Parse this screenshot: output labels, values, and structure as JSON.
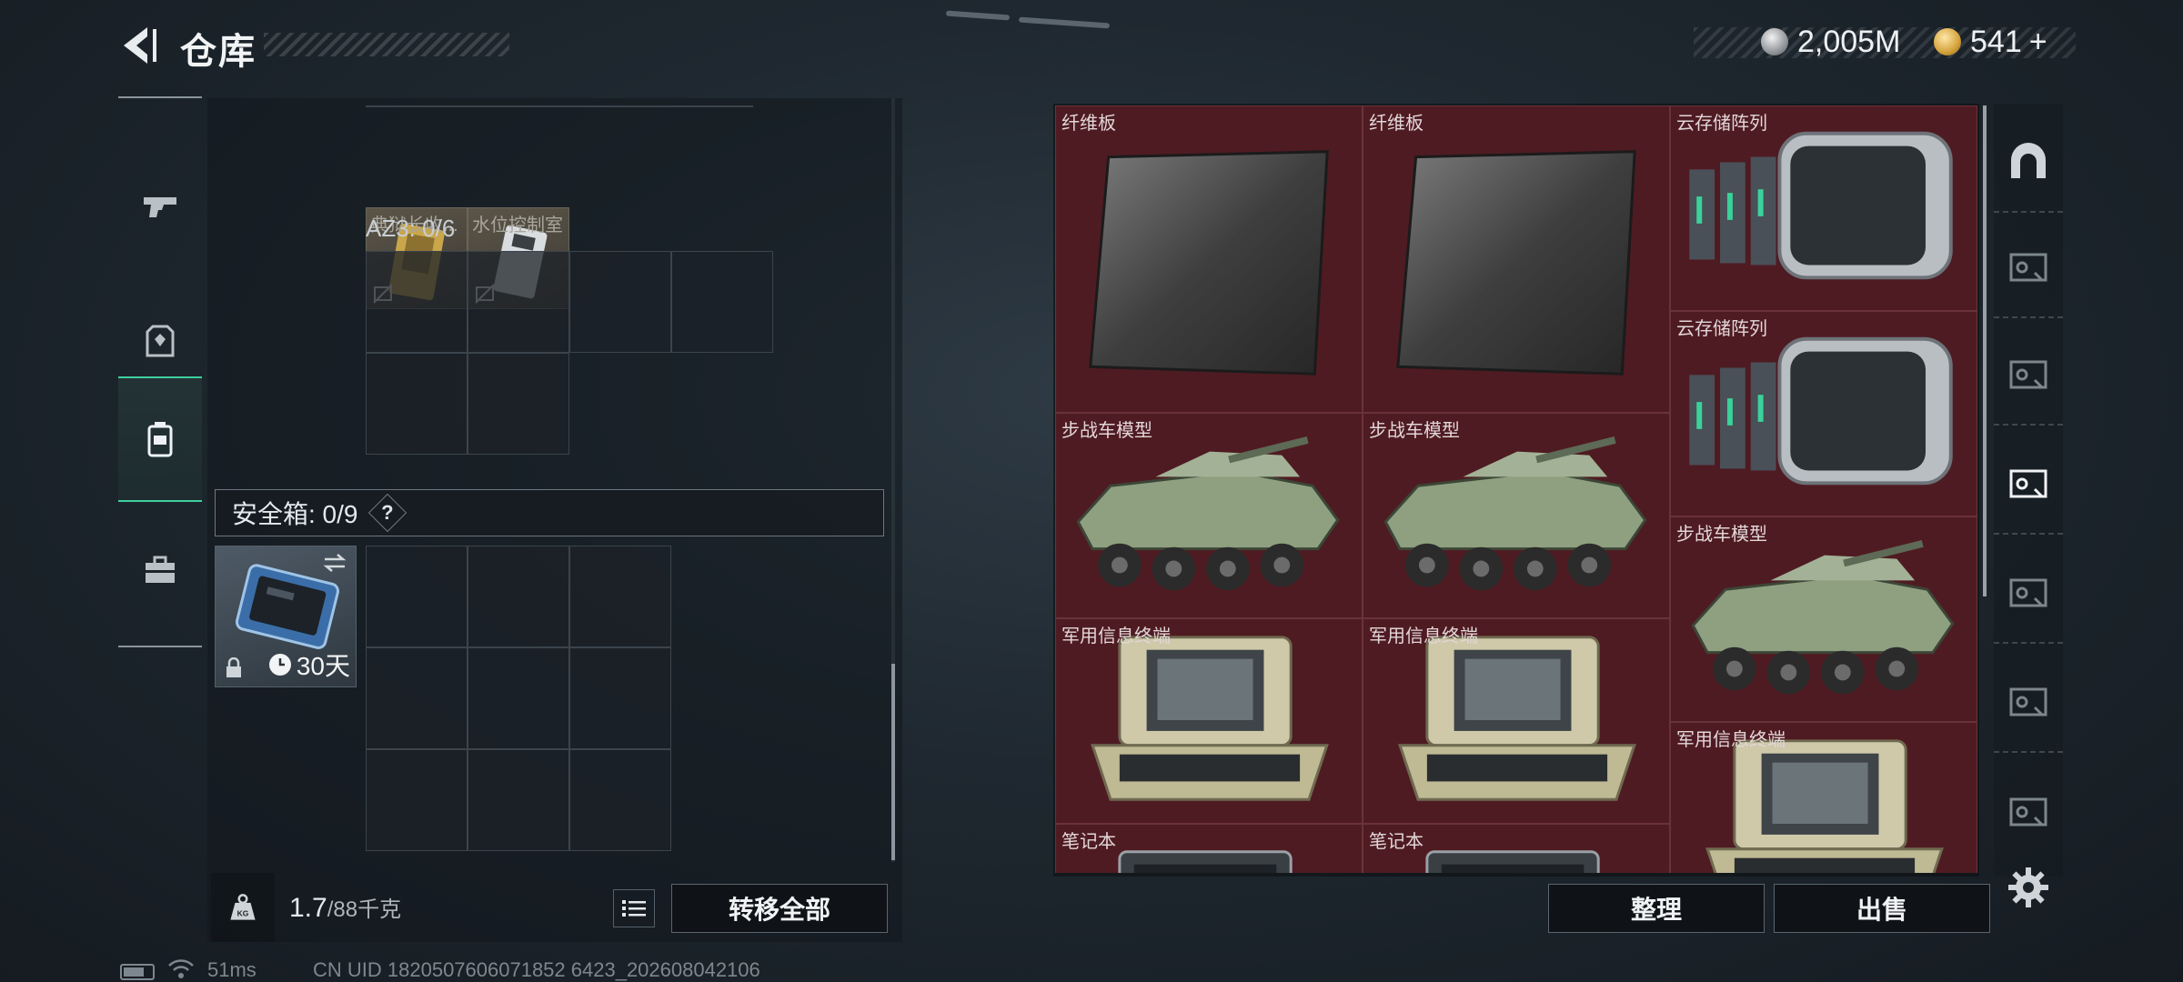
{
  "header": {
    "title": "仓库"
  },
  "currency": {
    "silver": "2,005M",
    "gold": "541",
    "gold_suffix": "+"
  },
  "left_rail": [
    "gun-icon",
    "armor-icon",
    "backpack-icon",
    "toolbox-icon"
  ],
  "container": {
    "mini_items": [
      {
        "label": "典狱长收..."
      },
      {
        "label": "水位控制室"
      }
    ],
    "grid_label": "AZ3: 0/6"
  },
  "safe_box": {
    "label": "安全箱: 0/9",
    "help": "?",
    "timer": "30天"
  },
  "weight": {
    "current": "1.7",
    "max": "/88千克"
  },
  "buttons": {
    "transfer_all": "转移全部",
    "organize": "整理",
    "sell": "出售"
  },
  "stash": {
    "items": [
      {
        "name": "纤维板",
        "kind": "board"
      },
      {
        "name": "纤维板",
        "kind": "board"
      },
      {
        "name": "云存储阵列",
        "kind": "server"
      },
      {
        "name": "云存储阵列",
        "kind": "server"
      },
      {
        "name": "步战车模型",
        "kind": "vehicle"
      },
      {
        "name": "步战车模型",
        "kind": "vehicle"
      },
      {
        "name": "步战车模型",
        "kind": "vehicle"
      },
      {
        "name": "军用信息终端",
        "kind": "terminal"
      },
      {
        "name": "军用信息终端",
        "kind": "terminal"
      },
      {
        "name": "军用信息终端",
        "kind": "terminal"
      },
      {
        "name": "笔记本",
        "kind": "laptop"
      },
      {
        "name": "笔记本",
        "kind": "laptop"
      }
    ]
  },
  "status": {
    "ping": "51ms",
    "uid": "CN UID 1820507606071852 6423_202608042106"
  },
  "colors": {
    "accent_green": "#3ecf9e",
    "stash_bg": "#571e26"
  }
}
